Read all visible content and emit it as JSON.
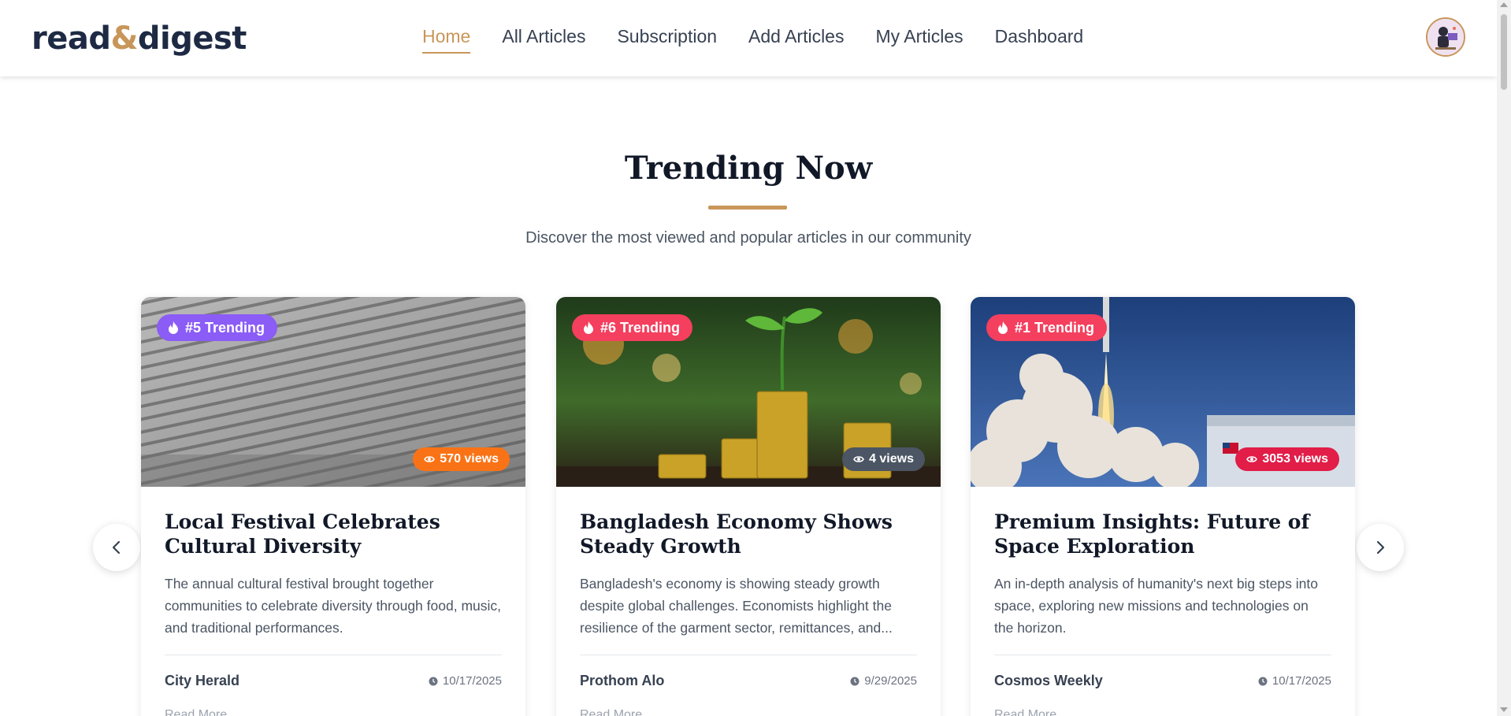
{
  "logo": {
    "part1": "read",
    "amp": "&",
    "part2": "digest"
  },
  "nav": [
    {
      "label": "Home",
      "active": true
    },
    {
      "label": "All Articles"
    },
    {
      "label": "Subscription"
    },
    {
      "label": "Add Articles"
    },
    {
      "label": "My Articles"
    },
    {
      "label": "Dashboard"
    }
  ],
  "section": {
    "title": "Trending Now",
    "subtitle": "Discover the most viewed and popular articles in our community"
  },
  "colors": {
    "accent": "#c8965a",
    "dark": "#1e2a44"
  },
  "cards": [
    {
      "badge": "#5 Trending",
      "badge_color": "#8b5cf6",
      "views": "570 views",
      "views_color": "#f97316",
      "image": "book-page",
      "title": "Local Festival Celebrates Cultural Diversity",
      "excerpt": "The annual cultural festival brought together communities to celebrate diversity through food, music, and traditional performances.",
      "publisher": "City Herald",
      "date": "10/17/2025",
      "more": "Read More"
    },
    {
      "badge": "#6 Trending",
      "badge_color": "#f43f5e",
      "views": "4 views",
      "views_color": "#4b5563",
      "image": "coins-plant",
      "title": "Bangladesh Economy Shows Steady Growth",
      "excerpt": "Bangladesh's economy is showing steady growth despite global challenges. Economists highlight the resilience of the garment sector, remittances, and...",
      "publisher": "Prothom Alo",
      "date": "9/29/2025",
      "more": "Read More"
    },
    {
      "badge": "#1 Trending",
      "badge_color": "#f43f5e",
      "views": "3053 views",
      "views_color": "#e11d48",
      "image": "rocket-launch",
      "title": "Premium Insights: Future of Space Exploration",
      "excerpt": "An in-depth analysis of humanity's next big steps into space, exploring new missions and technologies on the horizon.",
      "publisher": "Cosmos Weekly",
      "date": "10/17/2025",
      "more": "Read More"
    }
  ],
  "icons": {
    "fire": "fire-icon",
    "eye": "eye-icon",
    "clock": "clock-icon",
    "prev": "chevron-left-icon",
    "next": "chevron-right-icon"
  }
}
